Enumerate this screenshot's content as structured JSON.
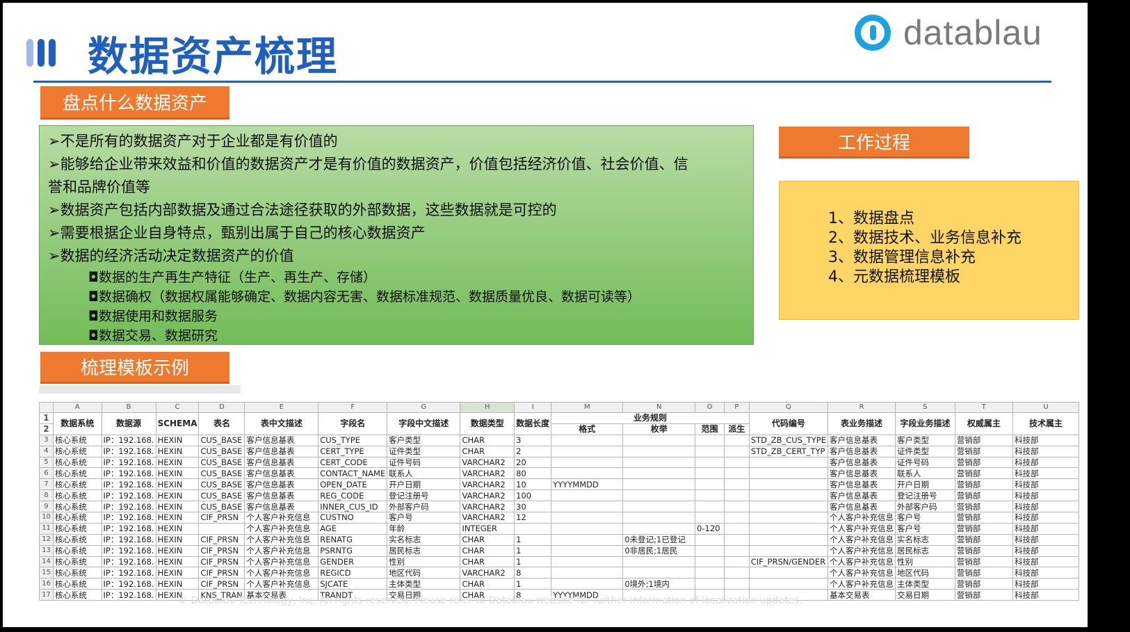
{
  "title": "数据资产梳理",
  "logo": "datablau",
  "section1": {
    "label": "盘点什么数据资产",
    "points": [
      "➢不是所有的数据资产对于企业都是有价值的",
      "➢能够给企业带来效益和价值的数据资产才是有价值的数据资产，价值包括经济价值、社会价值、信",
      "誉和品牌价值等",
      "➢数据资产包括内部数据及通过合法途径获取的外部数据，这些数据就是可控的",
      "➢需要根据企业自身特点，甄别出属于自己的核心数据资产",
      "➢数据的经济活动决定数据资产的价值"
    ],
    "subpoints": [
      "◘数据的生产再生产特征（生产、再生产、存储）",
      "◘数据确权（数据权属能够确定、数据内容无害、数据标准规范、数据质量优良、数据可读等）",
      "◘数据使用和数据服务",
      "◘数据交易、数据研究"
    ]
  },
  "work": {
    "label": "工作过程",
    "steps": [
      "1、数据盘点",
      "2、数据技术、业务信息补充",
      "3、数据管理信息补充",
      "4、元数据梳理模板"
    ]
  },
  "section2": {
    "label": "梳理模板示例"
  },
  "sheet": {
    "columns": [
      "A",
      "B",
      "C",
      "D",
      "E",
      "F",
      "G",
      "H",
      "I",
      "M",
      "N",
      "O",
      "P",
      "Q",
      "R",
      "S",
      "T",
      "U"
    ],
    "header1": [
      "数据系统",
      "数据源",
      "SCHEMA",
      "表名",
      "表中文描述",
      "字段名",
      "字段中文描述",
      "数据类型",
      "数据长度",
      "业务规则",
      "代码编号",
      "表业务描述",
      "字段业务描述",
      "权威属主",
      "技术属主"
    ],
    "header2": [
      "格式",
      "枚举",
      "范围",
      "派生"
    ],
    "row_numbers": [
      "3",
      "4",
      "5",
      "6",
      "7",
      "8",
      "9",
      "10",
      "11",
      "12",
      "13",
      "14",
      "15",
      "16",
      "17"
    ],
    "rows": [
      [
        "核心系统",
        "IP：192.168.",
        "HEXIN",
        "CUS_BASE",
        "客户信息基表",
        "CUS_TYPE",
        "客户类型",
        "CHAR",
        "3",
        "",
        "",
        "",
        "",
        "STD_ZB_CUS_TYPE",
        "客户信息基表",
        "客户类型",
        "营销部",
        "科技部"
      ],
      [
        "核心系统",
        "IP：192.168.",
        "HEXIN",
        "CUS_BASE",
        "客户信息基表",
        "CERT_TYPE",
        "证件类型",
        "CHAR",
        "2",
        "",
        "",
        "",
        "",
        "STD_ZB_CERT_TYP",
        "客户信息基表",
        "证件类型",
        "营销部",
        "科技部"
      ],
      [
        "核心系统",
        "IP：192.168.",
        "HEXIN",
        "CUS_BASE",
        "客户信息基表",
        "CERT_CODE",
        "证件号码",
        "VARCHAR2",
        "20",
        "",
        "",
        "",
        "",
        "",
        "客户信息基表",
        "证件号码",
        "营销部",
        "科技部"
      ],
      [
        "核心系统",
        "IP：192.168.",
        "HEXIN",
        "CUS_BASE",
        "客户信息基表",
        "CONTACT_NAME",
        "联系人",
        "VARCHAR2",
        "80",
        "",
        "",
        "",
        "",
        "",
        "客户信息基表",
        "联系人",
        "营销部",
        "科技部"
      ],
      [
        "核心系统",
        "IP：192.168.",
        "HEXIN",
        "CUS_BASE",
        "客户信息基表",
        "OPEN_DATE",
        "开户日期",
        "VARCHAR2",
        "10",
        "YYYYMMDD",
        "",
        "",
        "",
        "",
        "客户信息基表",
        "开户日期",
        "营销部",
        "科技部"
      ],
      [
        "核心系统",
        "IP：192.168.",
        "HEXIN",
        "CUS_BASE",
        "客户信息基表",
        "REG_CODE",
        "登记注册号",
        "VARCHAR2",
        "100",
        "",
        "",
        "",
        "",
        "",
        "客户信息基表",
        "登记注册号",
        "营销部",
        "科技部"
      ],
      [
        "核心系统",
        "IP：192.168.",
        "HEXIN",
        "CUS_BASE",
        "客户信息基表",
        "INNER_CUS_ID",
        "外部客户码",
        "VARCHAR2",
        "30",
        "",
        "",
        "",
        "",
        "",
        "客户信息基表",
        "外部客户码",
        "营销部",
        "科技部"
      ],
      [
        "核心系统",
        "IP：192.168.",
        "HEXIN",
        "CIF_PRSN",
        "个人客户补充信息",
        "CUSTNO",
        "客户号",
        "VARCHAR2",
        "12",
        "",
        "",
        "",
        "",
        "",
        "个人客户补充信息",
        "客户号",
        "营销部",
        "科技部"
      ],
      [
        "核心系统",
        "IP：192.168.",
        "HEXIN",
        "",
        "个人客户补充信息",
        "AGE",
        "年龄",
        "INTEGER",
        "",
        "",
        "",
        "0-120",
        "",
        "",
        "个人客户补充信息",
        "客户号",
        "营销部",
        "科技部"
      ],
      [
        "核心系统",
        "IP：192.168.",
        "HEXIN",
        "CIF_PRSN",
        "个人客户补充信息",
        "RENATG",
        "实名标志",
        "CHAR",
        "1",
        "",
        "0未登记;1已登记",
        "",
        "",
        "",
        "个人客户补充信息",
        "实名标志",
        "营销部",
        "科技部"
      ],
      [
        "核心系统",
        "IP：192.168.",
        "HEXIN",
        "CIF_PRSN",
        "个人客户补充信息",
        "PSRNTG",
        "居民标志",
        "CHAR",
        "1",
        "",
        "0非居民;1居民",
        "",
        "",
        "",
        "个人客户补充信息",
        "居民标志",
        "营销部",
        "科技部"
      ],
      [
        "核心系统",
        "IP：192.168.",
        "HEXIN",
        "CIF_PRSN",
        "个人客户补充信息",
        "GENDER",
        "性别",
        "CHAR",
        "1",
        "",
        "",
        "",
        "",
        "CIF_PRSN/GENDER",
        "个人客户补充信息",
        "性别",
        "营销部",
        "科技部"
      ],
      [
        "核心系统",
        "IP：192.168.",
        "HEXIN",
        "CIF_PRSN",
        "个人客户补充信息",
        "REGICD",
        "地区代码",
        "VARCHAR2",
        "8",
        "",
        "",
        "",
        "",
        "",
        "个人客户补充信息",
        "地区代码",
        "营销部",
        "科技部"
      ],
      [
        "核心系统",
        "IP：192.168.",
        "HEXIN",
        "CIF_PRSN",
        "个人客户补充信息",
        "SJCATE",
        "主体类型",
        "CHAR",
        "1",
        "",
        "0境外;1境内",
        "",
        "",
        "",
        "个人客户补充信息",
        "主体类型",
        "营销部",
        "科技部"
      ],
      [
        "核心系统",
        "IP：192.168.",
        "HEXIN",
        "KNS_TRAN",
        "基本交易表",
        "TRANDT",
        "交易日期",
        "CHAR",
        "8",
        "YYYYMMDD",
        "",
        "",
        "",
        "",
        "基本交易表",
        "交易日期",
        "营销部",
        "科技部"
      ]
    ]
  },
  "footer": "© Datablau Technology, Inc. All rights reserved. Please refer to Datablau website for further information of localization updates."
}
